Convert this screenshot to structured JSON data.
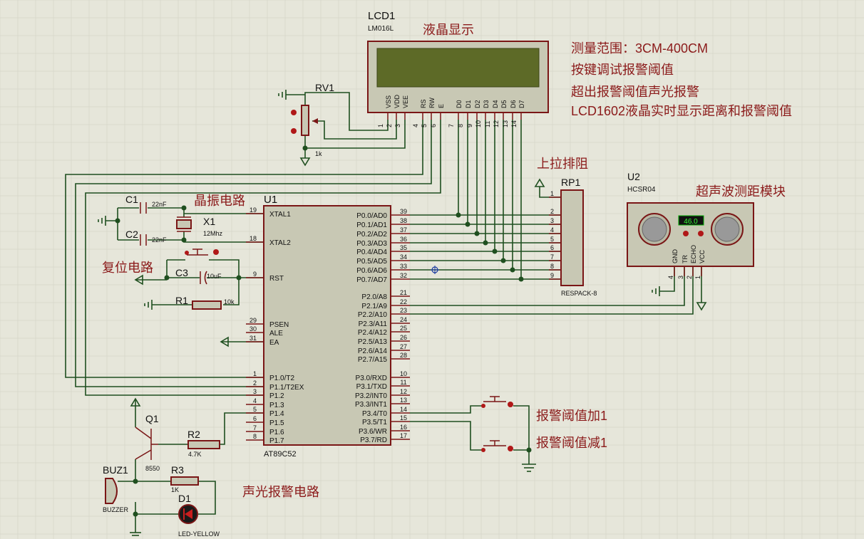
{
  "notes": [
    "测量范围：3CM-400CM",
    "按键调试报警阈值",
    "超出报警阈值声光报警",
    "LCD1602液晶实时显示距离和报警阈值"
  ],
  "section_labels": {
    "lcd": "液晶显示",
    "crystal": "晶振电路",
    "reset": "复位电路",
    "pullup": "上拉排阻",
    "ultrasonic": "超声波测距模块",
    "key_plus": "报警阈值加1",
    "key_minus": "报警阈值减1",
    "alarm": "声光报警电路"
  },
  "lcd": {
    "ref": "LCD1",
    "model": "LM016L",
    "pins": [
      "VSS",
      "VDD",
      "VEE",
      "RS",
      "RW",
      "E",
      "D0",
      "D1",
      "D2",
      "D3",
      "D4",
      "D5",
      "D6",
      "D7"
    ],
    "pin_numbers": [
      "1",
      "2",
      "3",
      "4",
      "5",
      "6",
      "7",
      "8",
      "9",
      "10",
      "11",
      "12",
      "13",
      "14"
    ]
  },
  "rv1": {
    "ref": "RV1",
    "value": "1k"
  },
  "mcu": {
    "ref": "U1",
    "model": "AT89C52",
    "left_pins": [
      {
        "num": "19",
        "name": "XTAL1"
      },
      {
        "num": "18",
        "name": "XTAL2"
      },
      {
        "num": "9",
        "name": "RST"
      },
      {
        "num": "29",
        "name": "PSEN"
      },
      {
        "num": "30",
        "name": "ALE"
      },
      {
        "num": "31",
        "name": "EA"
      },
      {
        "num": "1",
        "name": "P1.0/T2"
      },
      {
        "num": "2",
        "name": "P1.1/T2EX"
      },
      {
        "num": "3",
        "name": "P1.2"
      },
      {
        "num": "4",
        "name": "P1.3"
      },
      {
        "num": "5",
        "name": "P1.4"
      },
      {
        "num": "6",
        "name": "P1.5"
      },
      {
        "num": "7",
        "name": "P1.6"
      },
      {
        "num": "8",
        "name": "P1.7"
      }
    ],
    "right_pins": [
      {
        "num": "39",
        "name": "P0.0/AD0"
      },
      {
        "num": "38",
        "name": "P0.1/AD1"
      },
      {
        "num": "37",
        "name": "P0.2/AD2"
      },
      {
        "num": "36",
        "name": "P0.3/AD3"
      },
      {
        "num": "35",
        "name": "P0.4/AD4"
      },
      {
        "num": "34",
        "name": "P0.5/AD5"
      },
      {
        "num": "33",
        "name": "P0.6/AD6"
      },
      {
        "num": "32",
        "name": "P0.7/AD7"
      },
      {
        "num": "21",
        "name": "P2.0/A8"
      },
      {
        "num": "22",
        "name": "P2.1/A9"
      },
      {
        "num": "23",
        "name": "P2.2/A10"
      },
      {
        "num": "24",
        "name": "P2.3/A11"
      },
      {
        "num": "25",
        "name": "P2.4/A12"
      },
      {
        "num": "26",
        "name": "P2.5/A13"
      },
      {
        "num": "27",
        "name": "P2.6/A14"
      },
      {
        "num": "28",
        "name": "P2.7/A15"
      },
      {
        "num": "10",
        "name": "P3.0/RXD"
      },
      {
        "num": "11",
        "name": "P3.1/TXD"
      },
      {
        "num": "12",
        "name": "P3.2/INT0"
      },
      {
        "num": "13",
        "name": "P3.3/INT1"
      },
      {
        "num": "14",
        "name": "P3.4/T0"
      },
      {
        "num": "15",
        "name": "P3.5/T1"
      },
      {
        "num": "16",
        "name": "P3.6/WR"
      },
      {
        "num": "17",
        "name": "P3.7/RD"
      }
    ]
  },
  "c1": {
    "ref": "C1",
    "value": "22nF"
  },
  "c2": {
    "ref": "C2",
    "value": "22nF"
  },
  "x1": {
    "ref": "X1",
    "value": "12Mhz"
  },
  "c3": {
    "ref": "C3",
    "value": "10uF"
  },
  "r1": {
    "ref": "R1",
    "value": "10k"
  },
  "rp1": {
    "ref": "RP1",
    "model": "RESPACK-8",
    "pins": [
      "1",
      "2",
      "3",
      "4",
      "5",
      "6",
      "7",
      "8",
      "9"
    ]
  },
  "u2": {
    "ref": "U2",
    "model": "HCSR04",
    "reading": "46.0",
    "pins": [
      "GND",
      "TR",
      "ECHO",
      "VCC"
    ],
    "pin_numbers": [
      "4",
      "3",
      "2",
      "1"
    ]
  },
  "q1": {
    "ref": "Q1",
    "model": "8550"
  },
  "r2": {
    "ref": "R2",
    "value": "4.7K"
  },
  "r3": {
    "ref": "R3",
    "value": "1K"
  },
  "buz1": {
    "ref": "BUZ1",
    "model": "BUZZER"
  },
  "d1": {
    "ref": "D1",
    "model": "LED-YELLOW"
  }
}
